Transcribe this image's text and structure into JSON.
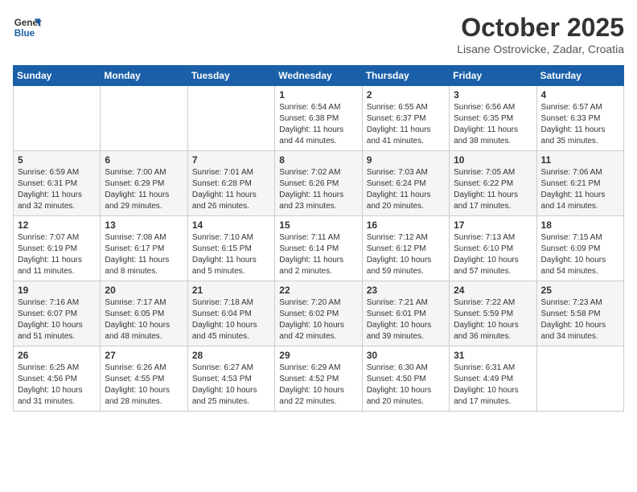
{
  "header": {
    "logo_general": "General",
    "logo_blue": "Blue",
    "month_title": "October 2025",
    "subtitle": "Lisane Ostrovicke, Zadar, Croatia"
  },
  "calendar": {
    "days_of_week": [
      "Sunday",
      "Monday",
      "Tuesday",
      "Wednesday",
      "Thursday",
      "Friday",
      "Saturday"
    ],
    "weeks": [
      [
        {
          "day": "",
          "info": ""
        },
        {
          "day": "",
          "info": ""
        },
        {
          "day": "",
          "info": ""
        },
        {
          "day": "1",
          "info": "Sunrise: 6:54 AM\nSunset: 6:38 PM\nDaylight: 11 hours\nand 44 minutes."
        },
        {
          "day": "2",
          "info": "Sunrise: 6:55 AM\nSunset: 6:37 PM\nDaylight: 11 hours\nand 41 minutes."
        },
        {
          "day": "3",
          "info": "Sunrise: 6:56 AM\nSunset: 6:35 PM\nDaylight: 11 hours\nand 38 minutes."
        },
        {
          "day": "4",
          "info": "Sunrise: 6:57 AM\nSunset: 6:33 PM\nDaylight: 11 hours\nand 35 minutes."
        }
      ],
      [
        {
          "day": "5",
          "info": "Sunrise: 6:59 AM\nSunset: 6:31 PM\nDaylight: 11 hours\nand 32 minutes."
        },
        {
          "day": "6",
          "info": "Sunrise: 7:00 AM\nSunset: 6:29 PM\nDaylight: 11 hours\nand 29 minutes."
        },
        {
          "day": "7",
          "info": "Sunrise: 7:01 AM\nSunset: 6:28 PM\nDaylight: 11 hours\nand 26 minutes."
        },
        {
          "day": "8",
          "info": "Sunrise: 7:02 AM\nSunset: 6:26 PM\nDaylight: 11 hours\nand 23 minutes."
        },
        {
          "day": "9",
          "info": "Sunrise: 7:03 AM\nSunset: 6:24 PM\nDaylight: 11 hours\nand 20 minutes."
        },
        {
          "day": "10",
          "info": "Sunrise: 7:05 AM\nSunset: 6:22 PM\nDaylight: 11 hours\nand 17 minutes."
        },
        {
          "day": "11",
          "info": "Sunrise: 7:06 AM\nSunset: 6:21 PM\nDaylight: 11 hours\nand 14 minutes."
        }
      ],
      [
        {
          "day": "12",
          "info": "Sunrise: 7:07 AM\nSunset: 6:19 PM\nDaylight: 11 hours\nand 11 minutes."
        },
        {
          "day": "13",
          "info": "Sunrise: 7:08 AM\nSunset: 6:17 PM\nDaylight: 11 hours\nand 8 minutes."
        },
        {
          "day": "14",
          "info": "Sunrise: 7:10 AM\nSunset: 6:15 PM\nDaylight: 11 hours\nand 5 minutes."
        },
        {
          "day": "15",
          "info": "Sunrise: 7:11 AM\nSunset: 6:14 PM\nDaylight: 11 hours\nand 2 minutes."
        },
        {
          "day": "16",
          "info": "Sunrise: 7:12 AM\nSunset: 6:12 PM\nDaylight: 10 hours\nand 59 minutes."
        },
        {
          "day": "17",
          "info": "Sunrise: 7:13 AM\nSunset: 6:10 PM\nDaylight: 10 hours\nand 57 minutes."
        },
        {
          "day": "18",
          "info": "Sunrise: 7:15 AM\nSunset: 6:09 PM\nDaylight: 10 hours\nand 54 minutes."
        }
      ],
      [
        {
          "day": "19",
          "info": "Sunrise: 7:16 AM\nSunset: 6:07 PM\nDaylight: 10 hours\nand 51 minutes."
        },
        {
          "day": "20",
          "info": "Sunrise: 7:17 AM\nSunset: 6:05 PM\nDaylight: 10 hours\nand 48 minutes."
        },
        {
          "day": "21",
          "info": "Sunrise: 7:18 AM\nSunset: 6:04 PM\nDaylight: 10 hours\nand 45 minutes."
        },
        {
          "day": "22",
          "info": "Sunrise: 7:20 AM\nSunset: 6:02 PM\nDaylight: 10 hours\nand 42 minutes."
        },
        {
          "day": "23",
          "info": "Sunrise: 7:21 AM\nSunset: 6:01 PM\nDaylight: 10 hours\nand 39 minutes."
        },
        {
          "day": "24",
          "info": "Sunrise: 7:22 AM\nSunset: 5:59 PM\nDaylight: 10 hours\nand 36 minutes."
        },
        {
          "day": "25",
          "info": "Sunrise: 7:23 AM\nSunset: 5:58 PM\nDaylight: 10 hours\nand 34 minutes."
        }
      ],
      [
        {
          "day": "26",
          "info": "Sunrise: 6:25 AM\nSunset: 4:56 PM\nDaylight: 10 hours\nand 31 minutes."
        },
        {
          "day": "27",
          "info": "Sunrise: 6:26 AM\nSunset: 4:55 PM\nDaylight: 10 hours\nand 28 minutes."
        },
        {
          "day": "28",
          "info": "Sunrise: 6:27 AM\nSunset: 4:53 PM\nDaylight: 10 hours\nand 25 minutes."
        },
        {
          "day": "29",
          "info": "Sunrise: 6:29 AM\nSunset: 4:52 PM\nDaylight: 10 hours\nand 22 minutes."
        },
        {
          "day": "30",
          "info": "Sunrise: 6:30 AM\nSunset: 4:50 PM\nDaylight: 10 hours\nand 20 minutes."
        },
        {
          "day": "31",
          "info": "Sunrise: 6:31 AM\nSunset: 4:49 PM\nDaylight: 10 hours\nand 17 minutes."
        },
        {
          "day": "",
          "info": ""
        }
      ]
    ]
  }
}
